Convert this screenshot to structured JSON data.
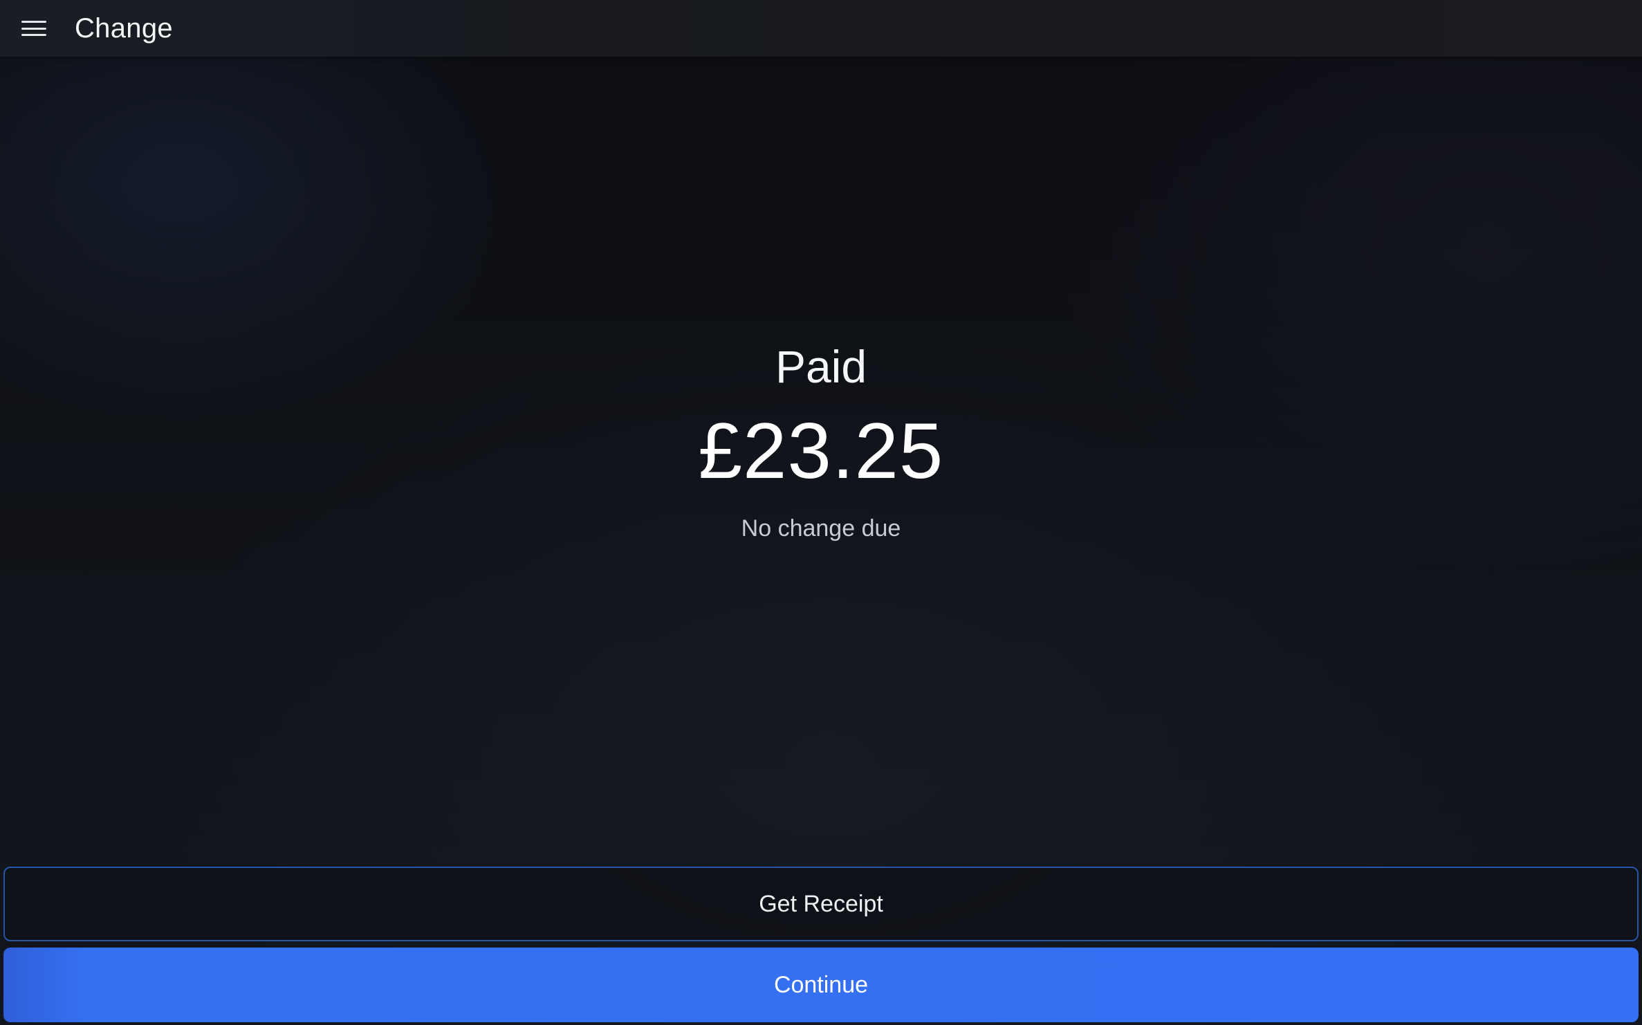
{
  "header": {
    "menu_icon": "hamburger-menu-icon",
    "title": "Change"
  },
  "summary": {
    "status_label": "Paid",
    "amount": "£23.25",
    "change_note": "No change due"
  },
  "actions": {
    "receipt_label": "Get Receipt",
    "continue_label": "Continue"
  },
  "colors": {
    "accent": "#356ff3",
    "receipt_border": "#2a54a8",
    "background": "#0e1015"
  }
}
